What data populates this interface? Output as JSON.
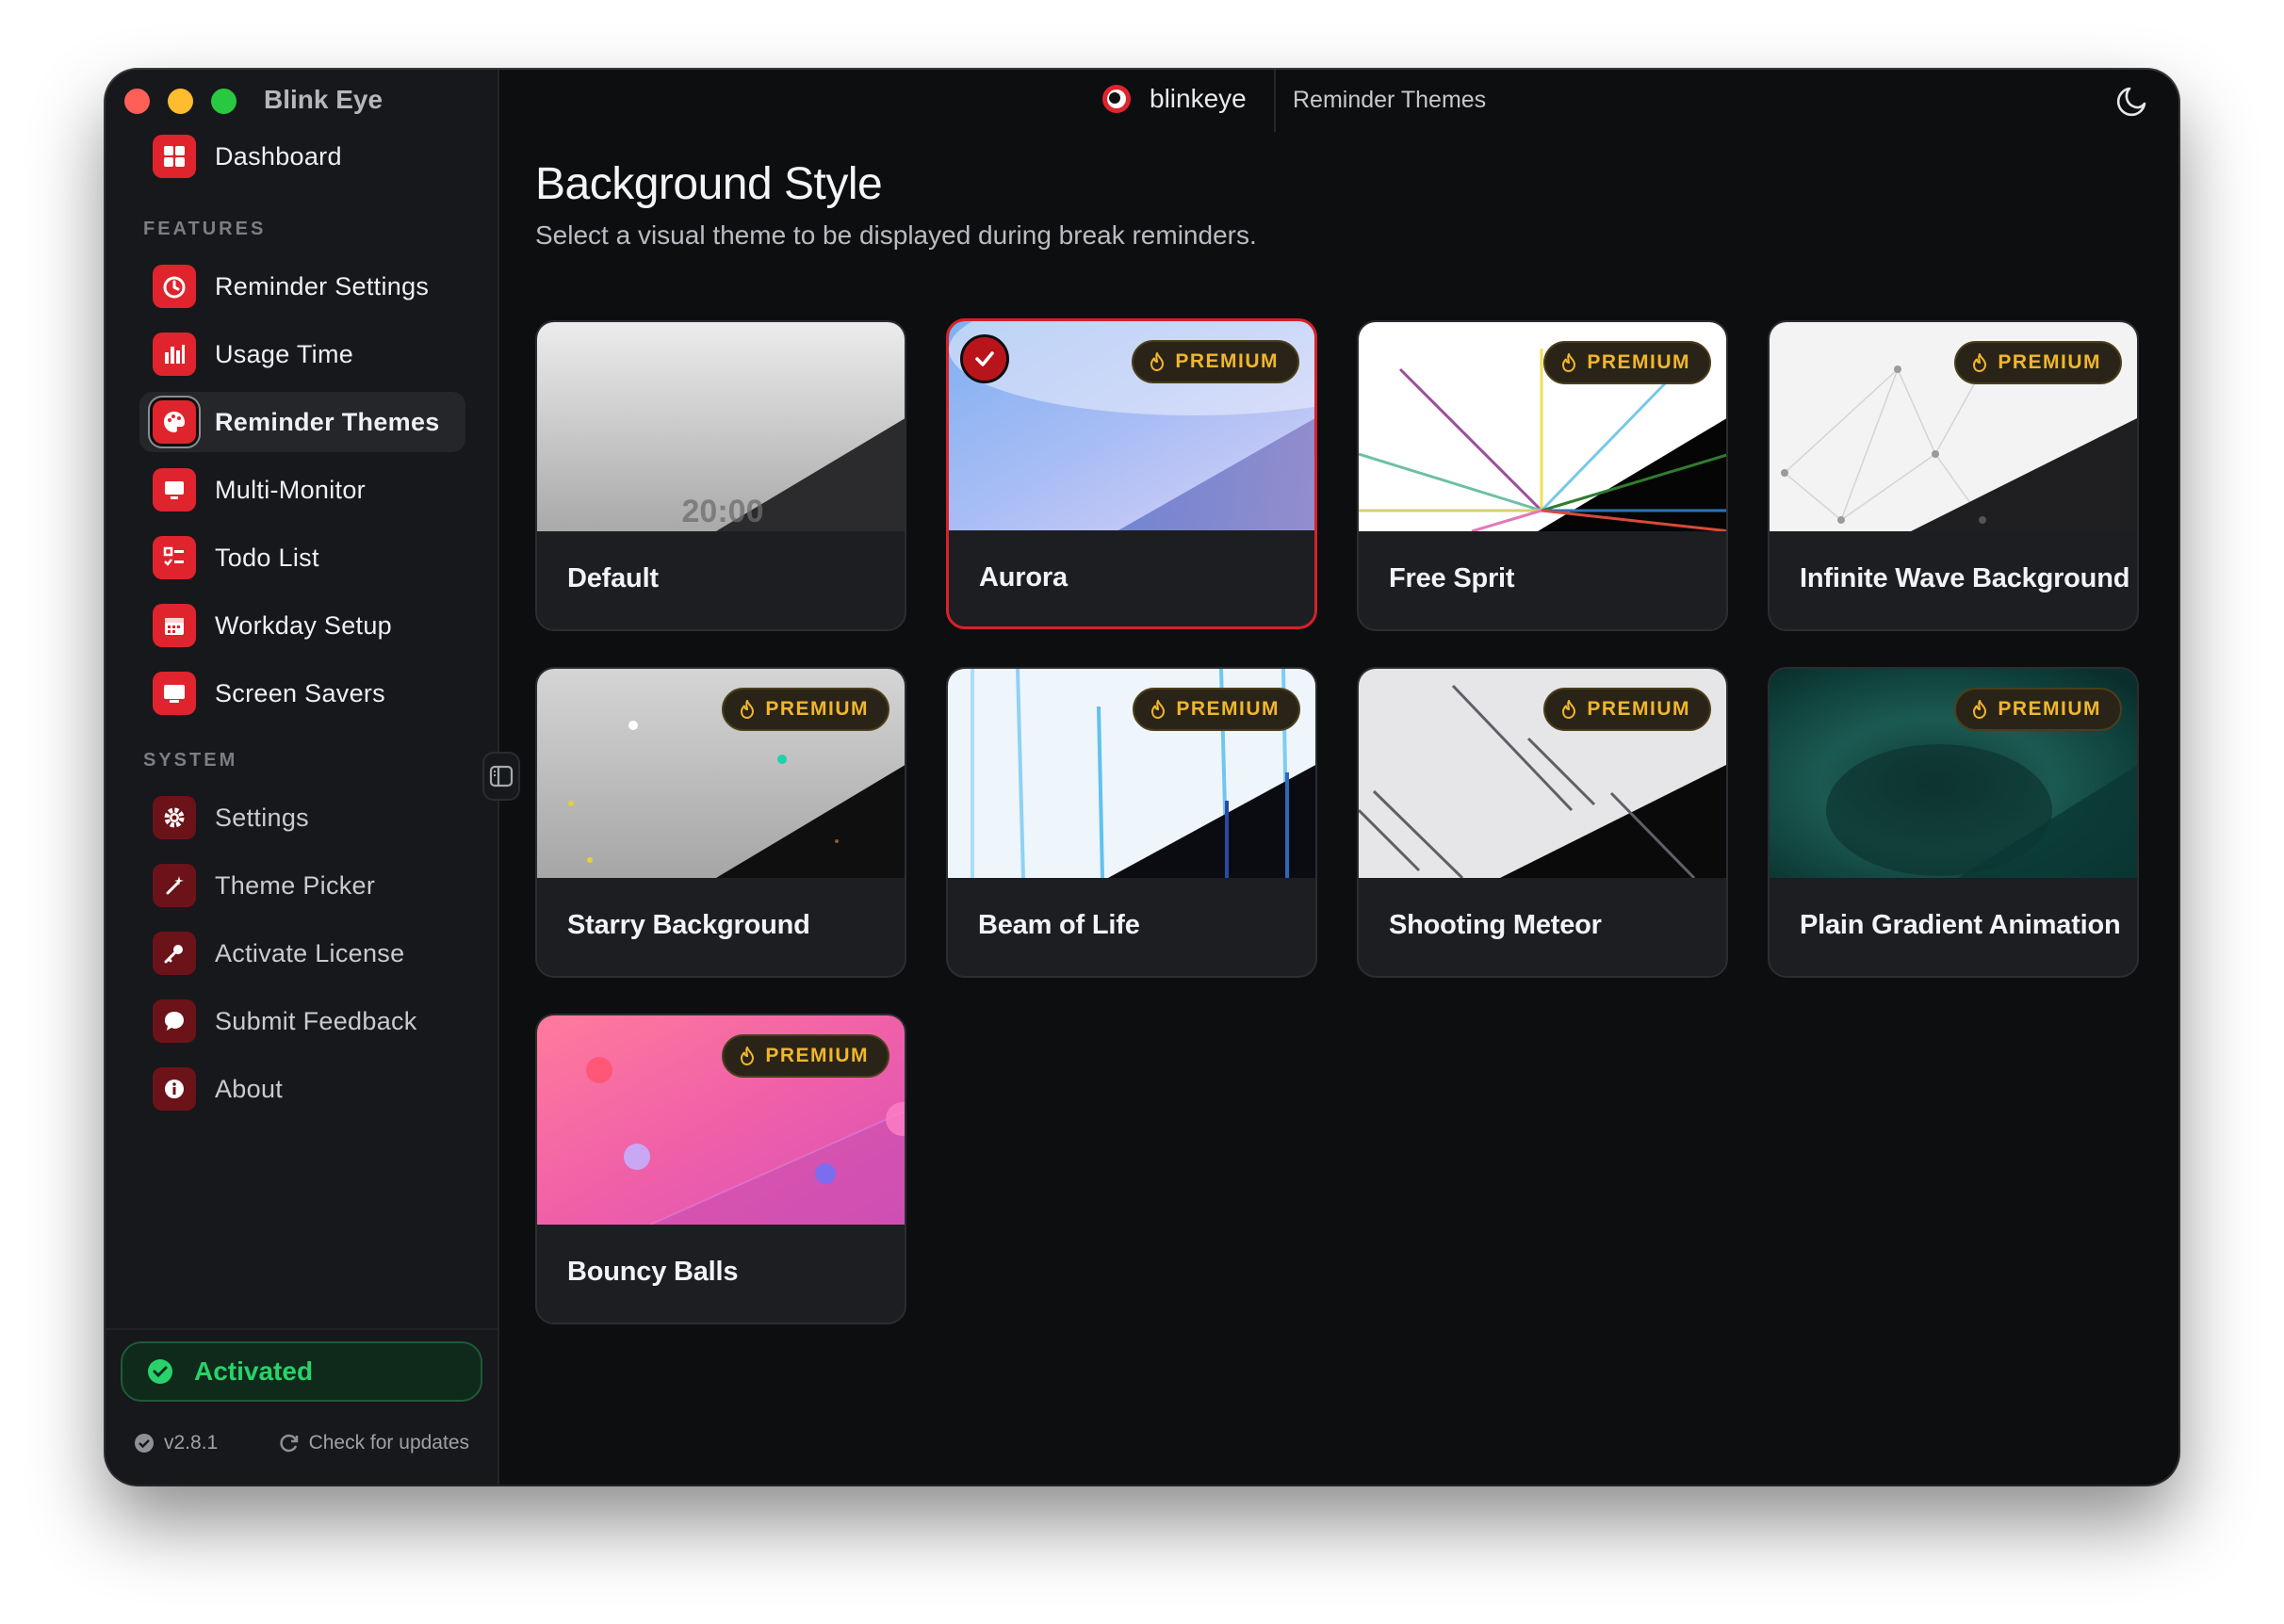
{
  "app": {
    "name": "Blink Eye"
  },
  "topbar": {
    "brand": "blinkeye",
    "breadcrumb": "Reminder Themes"
  },
  "sidebar": {
    "dashboard": "Dashboard",
    "features_title": "FEATURES",
    "features": [
      {
        "label": "Reminder Settings",
        "icon": "timer-icon"
      },
      {
        "label": "Usage Time",
        "icon": "bar-chart-icon"
      },
      {
        "label": "Reminder Themes",
        "icon": "palette-icon",
        "active": true
      },
      {
        "label": "Multi-Monitor",
        "icon": "monitor-icon"
      },
      {
        "label": "Todo List",
        "icon": "checklist-icon"
      },
      {
        "label": "Workday Setup",
        "icon": "calendar-icon"
      },
      {
        "label": "Screen Savers",
        "icon": "screen-icon"
      }
    ],
    "system_title": "SYSTEM",
    "system": [
      {
        "label": "Settings",
        "icon": "gear-icon"
      },
      {
        "label": "Theme Picker",
        "icon": "magic-wand-icon"
      },
      {
        "label": "Activate License",
        "icon": "key-icon"
      },
      {
        "label": "Submit Feedback",
        "icon": "chat-bubble-icon"
      },
      {
        "label": "About",
        "icon": "info-icon"
      }
    ],
    "status": "Activated",
    "version": "v2.8.1",
    "check_updates": "Check for updates"
  },
  "main": {
    "title": "Background Style",
    "subtitle": "Select a visual theme to be displayed during break reminders.",
    "premium_label": "PREMIUM",
    "default_preview_time": "20:00",
    "themes": [
      {
        "name": "Default",
        "premium": false,
        "selected": false
      },
      {
        "name": "Aurora",
        "premium": true,
        "selected": true
      },
      {
        "name": "Free Sprit",
        "premium": true,
        "selected": false
      },
      {
        "name": "Infinite Wave Background",
        "premium": true,
        "selected": false
      },
      {
        "name": "Starry Background",
        "premium": true,
        "selected": false
      },
      {
        "name": "Beam of Life",
        "premium": true,
        "selected": false
      },
      {
        "name": "Shooting Meteor",
        "premium": true,
        "selected": false
      },
      {
        "name": "Plain Gradient Animation",
        "premium": true,
        "selected": false
      },
      {
        "name": "Bouncy Balls",
        "premium": true,
        "selected": false
      }
    ]
  },
  "colors": {
    "accent": "#e0242d",
    "premium": "#f1b62c",
    "activated": "#29d26a"
  }
}
